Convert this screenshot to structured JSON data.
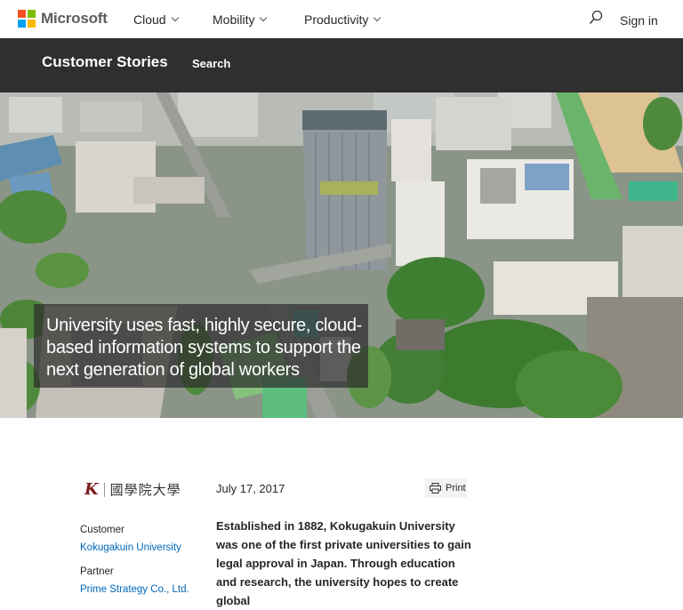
{
  "header": {
    "brand": "Microsoft",
    "nav": [
      "Cloud",
      "Mobility",
      "Productivity"
    ],
    "sign_in": "Sign in",
    "logo_colors": [
      "#f25022",
      "#7fba00",
      "#00a4ef",
      "#ffb900"
    ]
  },
  "subnav": {
    "title": "Customer Stories",
    "search": "Search"
  },
  "hero": {
    "headline": "University uses fast, highly secure, cloud-based information systems to support the next generation of global workers"
  },
  "story": {
    "org_logo_mark": "K",
    "org_logo_name": "國學院大學",
    "date": "July 17, 2017",
    "print_label": "Print",
    "customer_label": "Customer",
    "customer_value": "Kokugakuin University",
    "partner_label": "Partner",
    "partner_value": "Prime Strategy Co., Ltd.",
    "body": "Established in 1882, Kokugakuin University was one of the first private universities to gain legal approval in Japan. Through education and research, the university hopes to create global"
  },
  "colors": {
    "subnav_bg": "#2f2f2f",
    "link": "#0067b8"
  }
}
